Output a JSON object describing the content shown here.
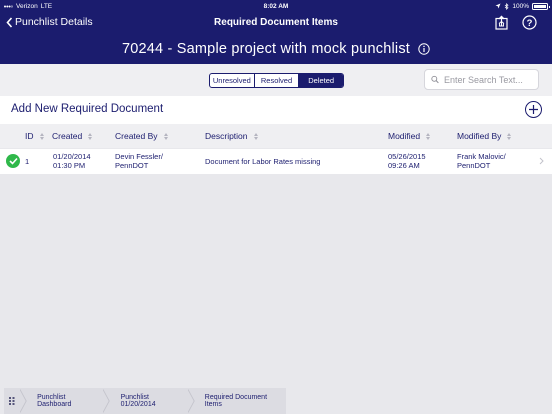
{
  "status_bar": {
    "carrier": "Verizon",
    "network": "LTE",
    "time": "8:02 AM",
    "battery": "100%"
  },
  "nav": {
    "back_label": "Punchlist Details",
    "title": "Required Document Items",
    "icons": [
      "export-icon",
      "help-icon"
    ]
  },
  "project": {
    "title": "70244 - Sample project with mock punchlist"
  },
  "filter": {
    "tabs": [
      "Unresolved",
      "Resolved",
      "Deleted"
    ],
    "selected": "Deleted"
  },
  "search": {
    "placeholder": "Enter Search Text..."
  },
  "add": {
    "label": "Add New Required Document"
  },
  "table": {
    "columns": [
      "ID",
      "Created",
      "Created By",
      "Description",
      "Modified",
      "Modified By"
    ],
    "rows": [
      {
        "status_icon": "check-icon",
        "id": "1",
        "created_date": "01/20/2014",
        "created_time": "01:30 PM",
        "created_by_name": "Devin Fessler/",
        "created_by_org": "PennDOT",
        "description": "Document for Labor Rates missing",
        "modified_date": "05/26/2015",
        "modified_time": "09:26 AM",
        "modified_by_name": "Frank Malovic/",
        "modified_by_org": "PennDOT"
      }
    ]
  },
  "breadcrumb": {
    "items": [
      "Punchlist Dashboard",
      "Punchlist 01/20/2014",
      "Required Document Items"
    ]
  },
  "colors": {
    "brand": "#1b1c6e",
    "success": "#2fb84a",
    "background": "#e8e8ec"
  }
}
